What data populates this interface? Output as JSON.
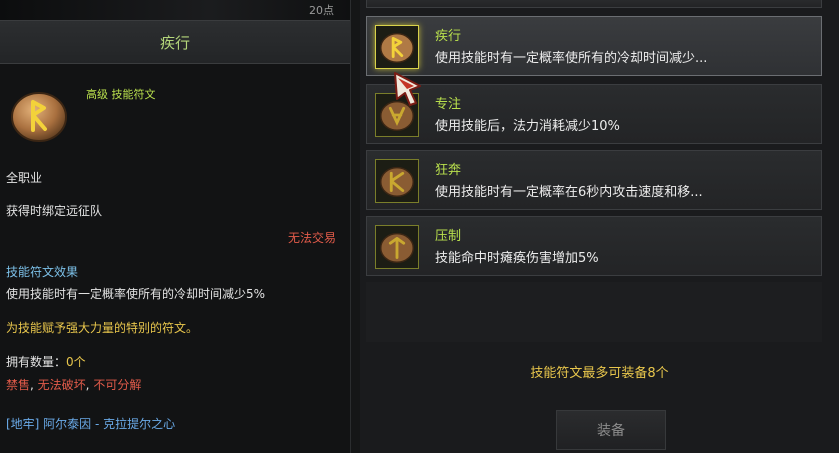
{
  "tooltip": {
    "top_value": "20点",
    "title": "疾行",
    "grade": "高级 技能符文",
    "job": "全职业",
    "bind": "获得时绑定远征队",
    "no_trade": "无法交易",
    "effect_title": "技能符文效果",
    "effect_desc": "使用技能时有一定概率使所有的冷却时间减少5%",
    "flavor": "为技能赋予强大力量的特别的符文。",
    "owned_label": "拥有数量：",
    "owned_value": "0个",
    "restrict_1": "禁售",
    "restrict_2": "无法破坏",
    "restrict_3": "不可分解",
    "dungeon": "[地牢] 阿尔泰因 - 克拉提尔之心"
  },
  "runes": [
    {
      "name": "疾行",
      "desc": "使用技能时有一定概率使所有的冷却时间减少..."
    },
    {
      "name": "专注",
      "desc": "使用技能后，法力消耗减少10%"
    },
    {
      "name": "狂奔",
      "desc": "使用技能时有一定概率在6秒内攻击速度和移..."
    },
    {
      "name": "压制",
      "desc": "技能命中时瘫痪伤害增加5%"
    }
  ],
  "footer_note": "技能符文最多可装备8个",
  "equip_label": "装备",
  "colors": {
    "rune_name": "#b9e04d",
    "gold": "#e8c64c",
    "red": "#e25b4a",
    "blue": "#6aaae8"
  }
}
